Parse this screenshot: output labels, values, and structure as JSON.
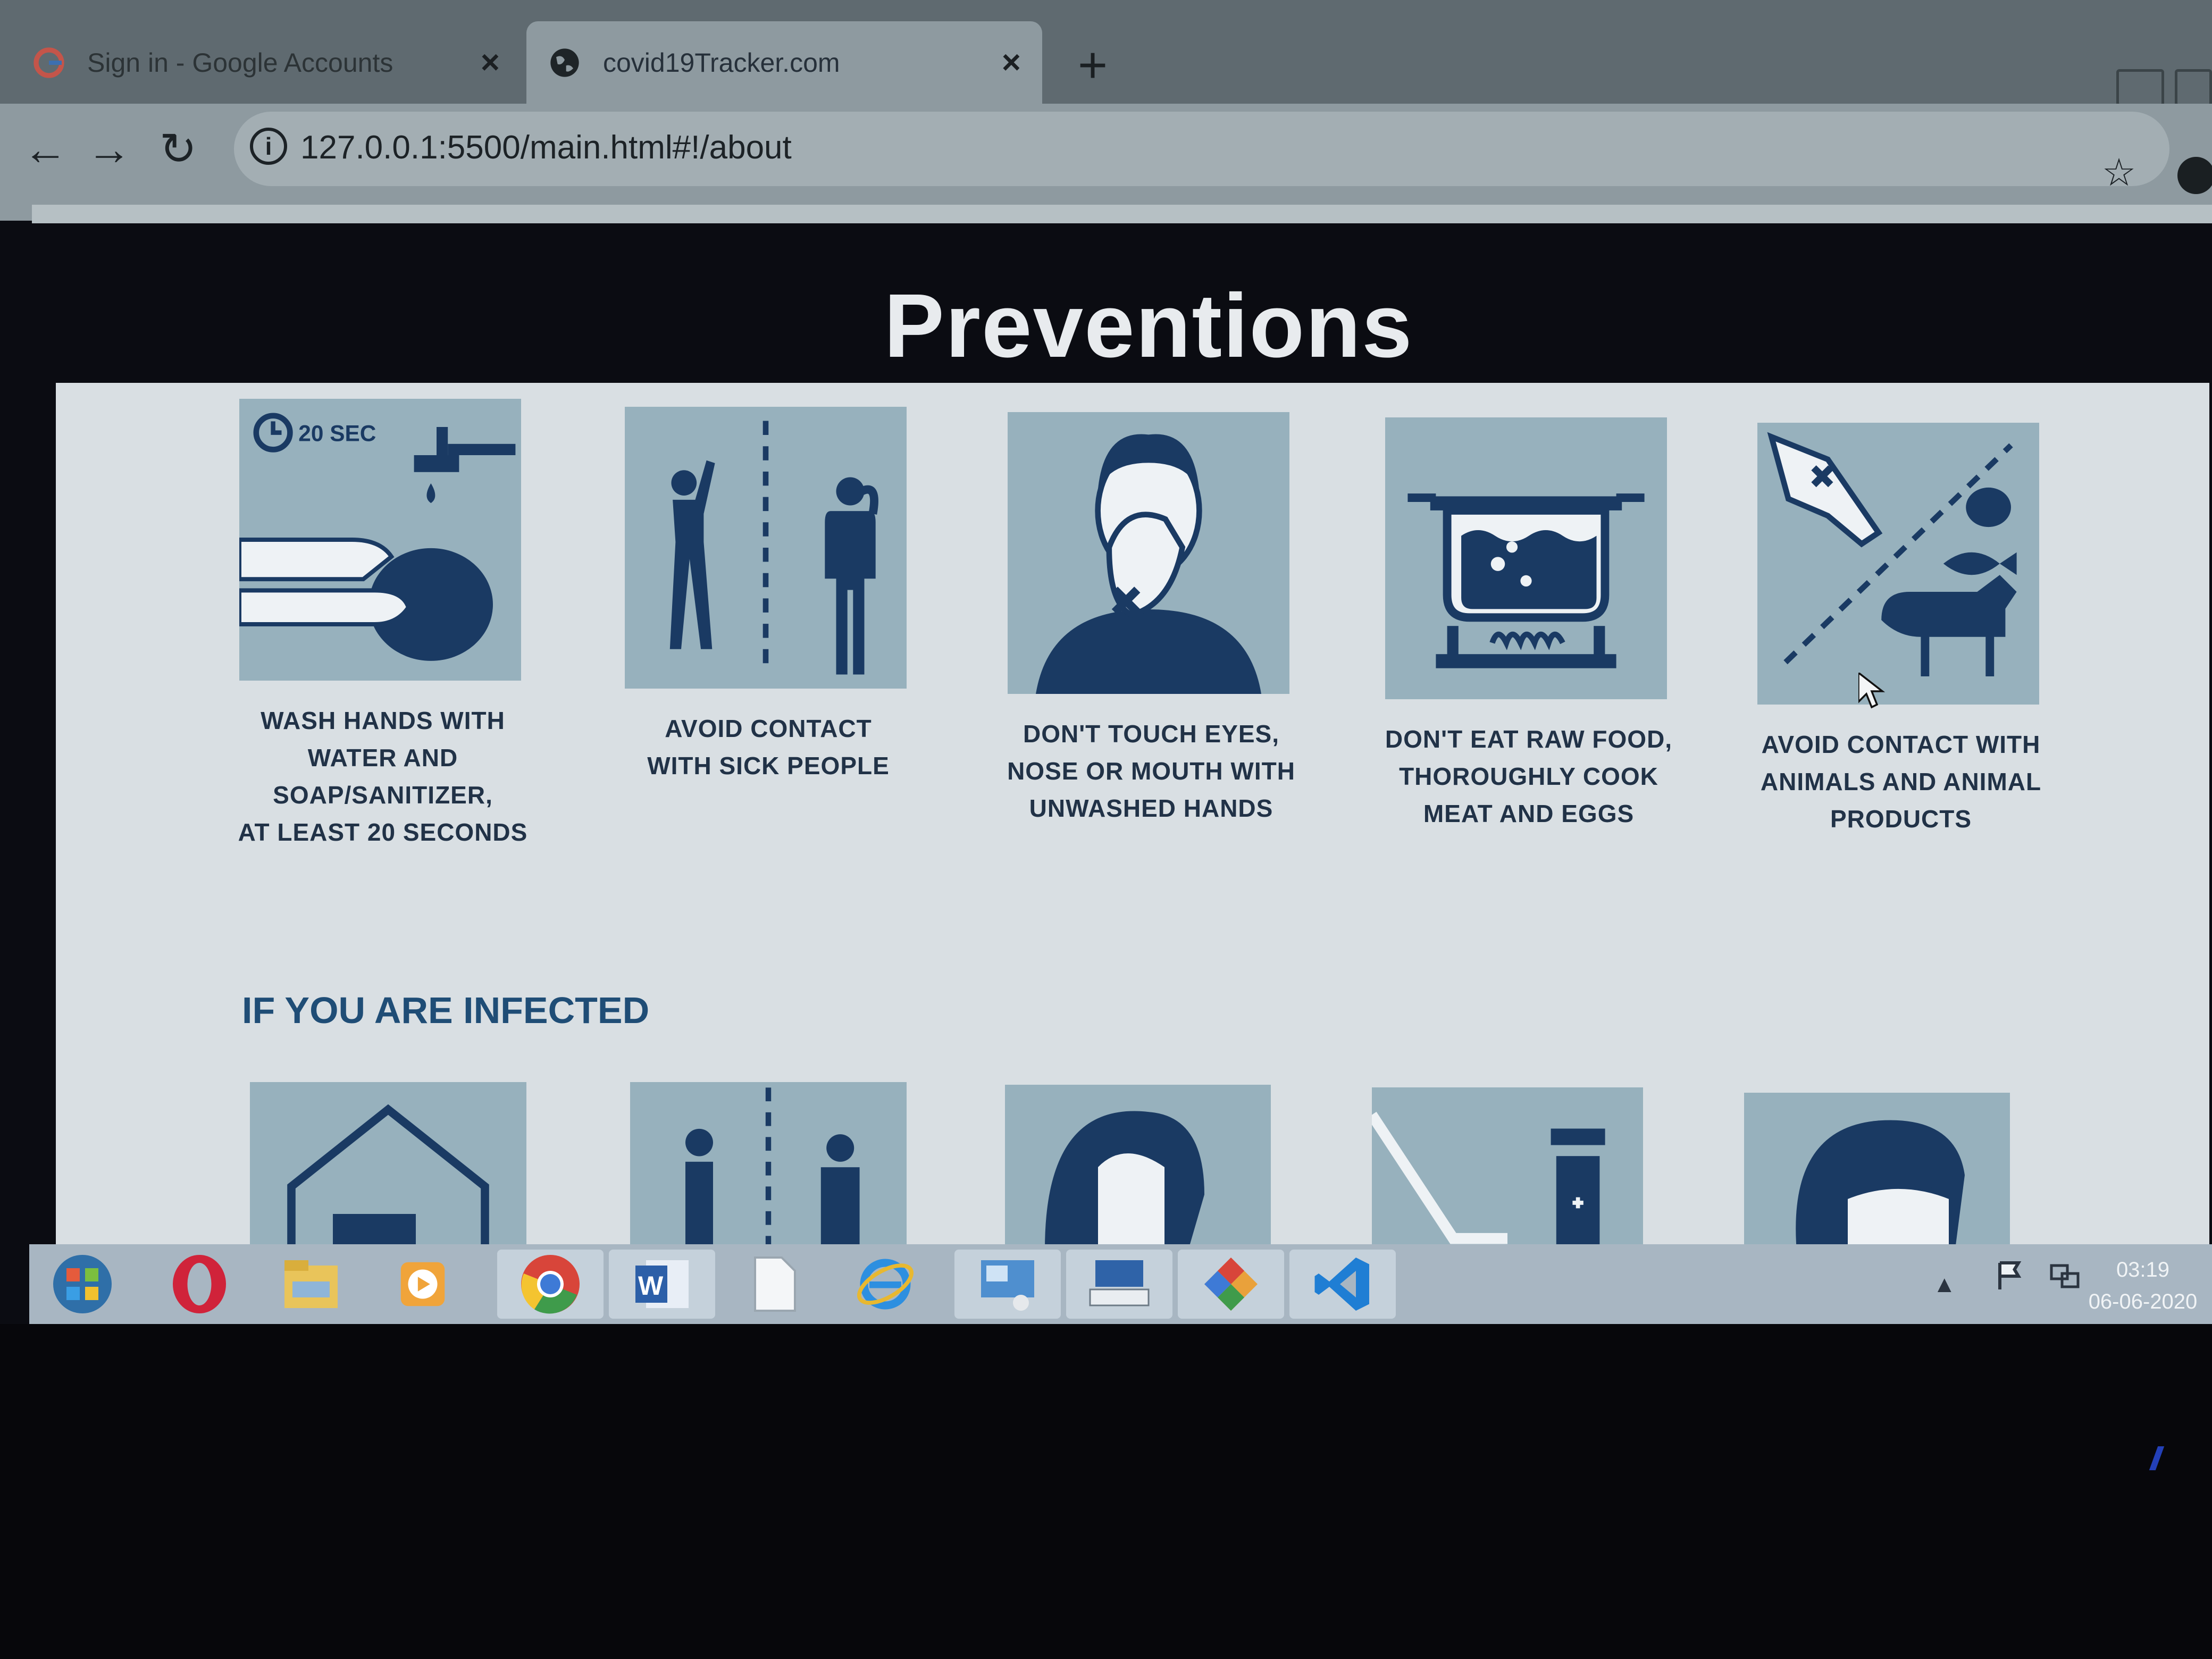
{
  "browser": {
    "tabs": [
      {
        "title": "Sign in - Google Accounts",
        "close": "×",
        "icon": "google-g-icon"
      },
      {
        "title": "covid19Tracker.com",
        "close": "×",
        "icon": "globe-icon"
      }
    ],
    "new_tab": "+",
    "nav": {
      "back": "←",
      "forward": "→",
      "reload": "↻"
    },
    "url": "127.0.0.1:5500/main.html#!/about",
    "info_icon": "i",
    "bookmark_star": "☆"
  },
  "page": {
    "heading": "Preventions",
    "preventions": [
      {
        "icon": "hand-washing-icon",
        "timer_label": "20 SEC",
        "caption": [
          "WASH HANDS WITH",
          "WATER AND",
          "SOAP/SANITIZER,",
          "AT LEAST 20 SECONDS"
        ]
      },
      {
        "icon": "distance-icon",
        "caption": [
          "AVOID CONTACT",
          "WITH SICK PEOPLE"
        ]
      },
      {
        "icon": "no-face-touch-icon",
        "caption": [
          "DON'T TOUCH EYES,",
          "NOSE OR MOUTH WITH",
          "UNWASHED HANDS"
        ]
      },
      {
        "icon": "cooking-pot-icon",
        "caption": [
          "DON'T EAT RAW FOOD,",
          "THOROUGHLY COOK",
          "MEAT AND EGGS"
        ]
      },
      {
        "icon": "animal-contact-icon",
        "caption": [
          "AVOID CONTACT WITH",
          "ANIMALS AND ANIMAL",
          "PRODUCTS"
        ]
      }
    ],
    "infected_heading": "IF YOU ARE INFECTED",
    "infected_icons": [
      "home-icon",
      "distance-icon",
      "cough-icon",
      "disinfect-spray-icon",
      "face-mask-icon"
    ]
  },
  "taskbar": {
    "apps": [
      "windows-start-icon",
      "opera-icon",
      "file-explorer-icon",
      "media-player-icon",
      "chrome-icon",
      "word-icon",
      "blank-file-icon",
      "internet-explorer-icon",
      "control-panel-icon",
      "keyboard-icon",
      "paint-icon",
      "vscode-icon"
    ],
    "tray": [
      "tray-arrow-icon",
      "action-center-flag-icon",
      "network-icon"
    ],
    "time": "03:19",
    "date": "06-06-2020"
  },
  "colors": {
    "icon_bg": "#97b1bd",
    "icon_fg": "#1a3a63",
    "caption": "#213247",
    "accent_heading": "#1f4d76"
  }
}
